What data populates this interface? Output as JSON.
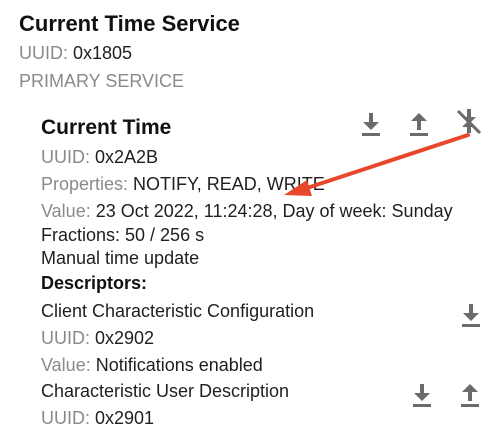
{
  "service": {
    "title": "Current Time Service",
    "uuid_label": "UUID: ",
    "uuid_value": "0x1805",
    "type": "PRIMARY SERVICE"
  },
  "characteristic": {
    "title": "Current Time",
    "uuid_label": "UUID: ",
    "uuid_value": "0x2A2B",
    "properties_label": "Properties: ",
    "properties_value": "NOTIFY, READ, WRITE",
    "value_label": "Value: ",
    "value_value": "23 Oct 2022, 11:24:28, Day of week: Sunday",
    "fractions": "Fractions: 50 / 256 s",
    "adjust_reason": "Manual time update",
    "descriptors_heading": "Descriptors:",
    "actions": [
      "download-icon",
      "upload-icon",
      "notify-disabled-icon"
    ]
  },
  "descriptors": [
    {
      "name": "Client Characteristic Configuration",
      "uuid_label": "UUID: ",
      "uuid_value": "0x2902",
      "value_label": "Value: ",
      "value_value": "Notifications enabled",
      "actions": [
        "download-icon"
      ]
    },
    {
      "name": "Characteristic User Description",
      "uuid_label": "UUID: ",
      "uuid_value": "0x2901",
      "actions": [
        "download-icon",
        "upload-icon"
      ]
    }
  ],
  "colors": {
    "icon": "#6b6b6b",
    "label_grey": "#8a8a8a",
    "annotation_arrow": "#e8472b"
  }
}
